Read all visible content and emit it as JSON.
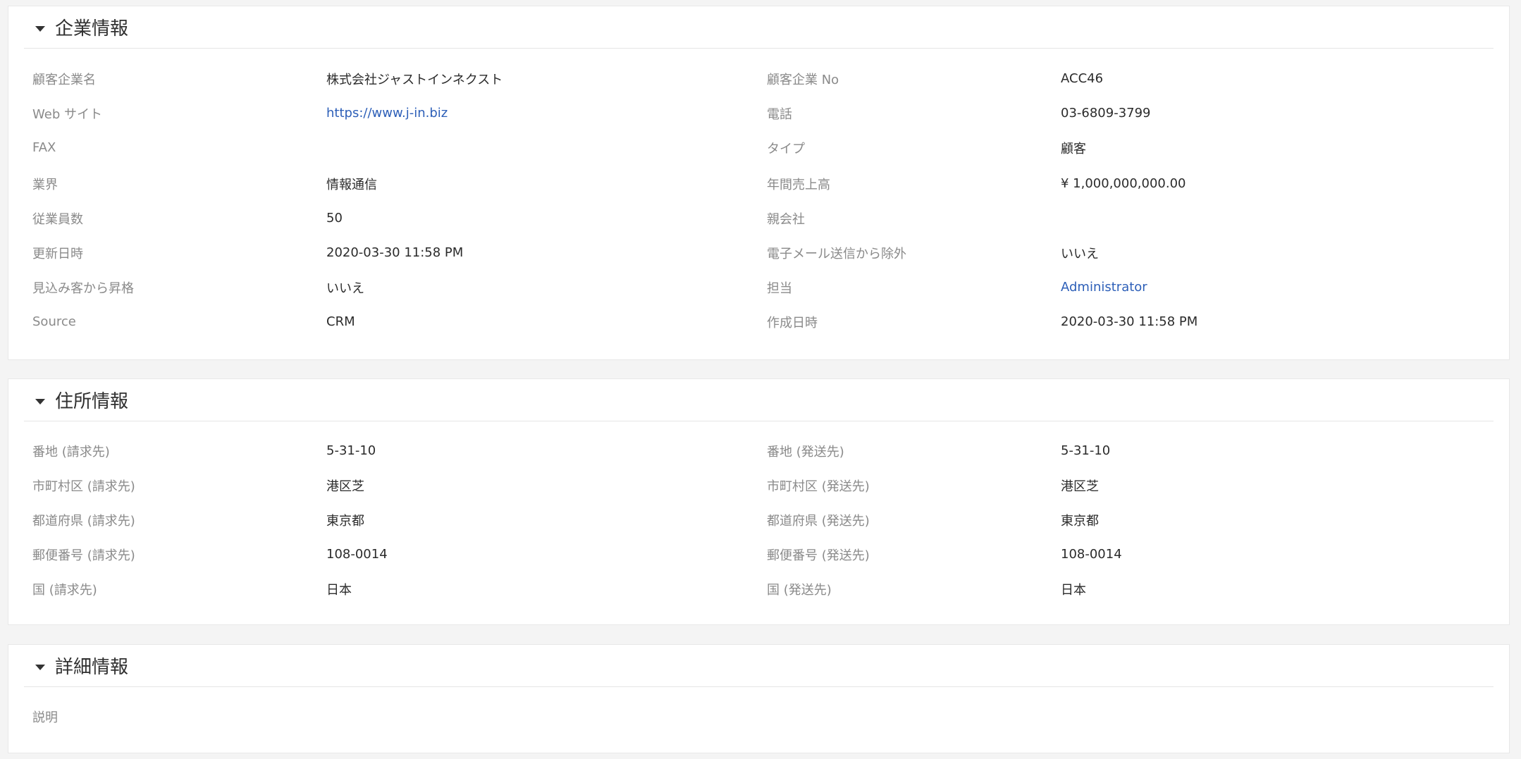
{
  "sections": {
    "company": {
      "title": "企業情報",
      "rows": [
        {
          "l1": "顧客企業名",
          "v1": "株式会社ジャストインネクスト",
          "l2": "顧客企業 No",
          "v2": "ACC46"
        },
        {
          "l1": "Web サイト",
          "v1": "https://www.j-in.biz",
          "l2": "電話",
          "v2": "03-6809-3799"
        },
        {
          "l1": "FAX",
          "v1": "",
          "l2": "タイプ",
          "v2": "顧客"
        },
        {
          "l1": "業界",
          "v1": "情報通信",
          "l2": "年間売上高",
          "v2": "¥ 1,000,000,000.00"
        },
        {
          "l1": "従業員数",
          "v1": "50",
          "l2": "親会社",
          "v2": ""
        },
        {
          "l1": "更新日時",
          "v1": "2020-03-30 11:58 PM",
          "l2": "電子メール送信から除外",
          "v2": "いいえ"
        },
        {
          "l1": "見込み客から昇格",
          "v1": "いいえ",
          "l2": "担当",
          "v2": "Administrator"
        },
        {
          "l1": "Source",
          "v1": "CRM",
          "l2": "作成日時",
          "v2": "2020-03-30 11:58 PM"
        }
      ]
    },
    "address": {
      "title": "住所情報",
      "rows": [
        {
          "l1": "番地 (請求先)",
          "v1": "5-31-10",
          "l2": "番地 (発送先)",
          "v2": "5-31-10"
        },
        {
          "l1": "市町村区 (請求先)",
          "v1": "港区芝",
          "l2": "市町村区 (発送先)",
          "v2": "港区芝"
        },
        {
          "l1": "都道府県 (請求先)",
          "v1": "東京都",
          "l2": "都道府県 (発送先)",
          "v2": "東京都"
        },
        {
          "l1": "郵便番号 (請求先)",
          "v1": "108-0014",
          "l2": "郵便番号 (発送先)",
          "v2": "108-0014"
        },
        {
          "l1": "国 (請求先)",
          "v1": "日本",
          "l2": "国 (発送先)",
          "v2": "日本"
        }
      ]
    },
    "detail": {
      "title": "詳細情報",
      "rows": [
        {
          "l1": "説明"
        }
      ]
    }
  },
  "colors": {
    "link": "#2d5fb8",
    "label": "#8a8a8a",
    "value": "#2b2b2b"
  }
}
